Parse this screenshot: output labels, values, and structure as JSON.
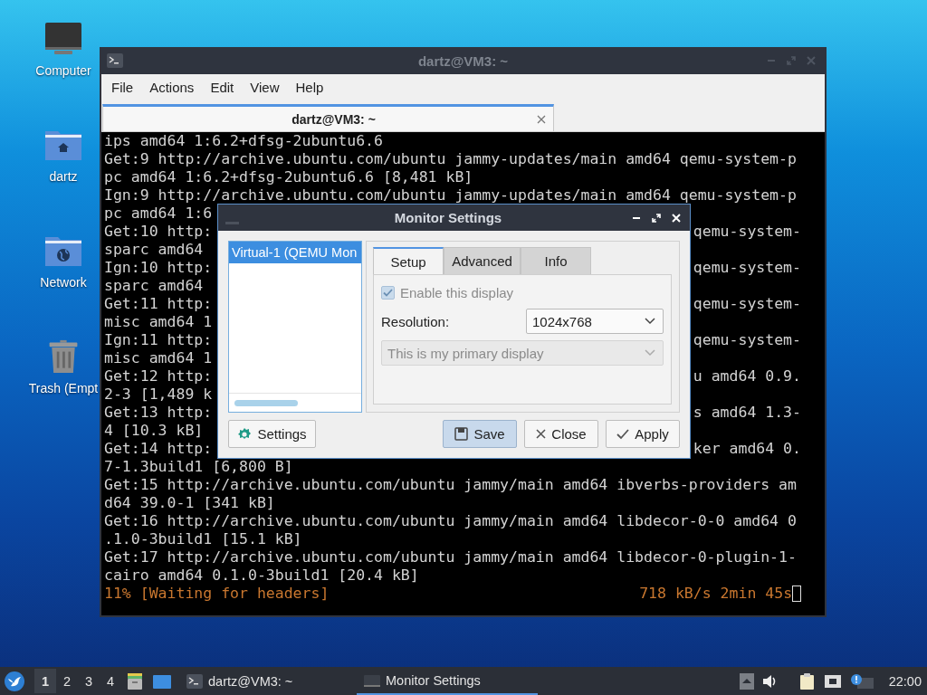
{
  "desktop_icons": [
    {
      "label": "Computer",
      "kind": "computer"
    },
    {
      "label": "dartz",
      "kind": "home"
    },
    {
      "label": "Network",
      "kind": "network"
    },
    {
      "label": "Trash (Empt",
      "kind": "trash"
    }
  ],
  "terminal": {
    "title": "dartz@VM3: ~",
    "menu": [
      "File",
      "Actions",
      "Edit",
      "View",
      "Help"
    ],
    "tabs": [
      {
        "label": "dartz@VM3: ~",
        "selected": true
      }
    ],
    "lines": [
      {
        "kind": "output",
        "left": "ips amd64 1:6.2+dfsg-2ubuntu6.6"
      },
      {
        "kind": "output",
        "left": "Get:9 http://archive.ubuntu.com/ubuntu jammy-updates/main amd64 qemu-system-p"
      },
      {
        "kind": "output",
        "left": "pc amd64 1:6.2+dfsg-2ubuntu6.6 [8,481 kB]"
      },
      {
        "kind": "output",
        "left": "Ign:9 http://archive.ubuntu.com/ubuntu jammy-updates/main amd64 qemu-system-p"
      },
      {
        "kind": "output",
        "left": "pc amd64 1:6"
      },
      {
        "kind": "output",
        "left": "Get:10 http:",
        "right": "qemu-system-"
      },
      {
        "kind": "output",
        "left": "sparc amd64 "
      },
      {
        "kind": "output",
        "left": "Ign:10 http:",
        "right": "qemu-system-"
      },
      {
        "kind": "output",
        "left": "sparc amd64 "
      },
      {
        "kind": "output",
        "left": "Get:11 http:",
        "right": "qemu-system-"
      },
      {
        "kind": "output",
        "left": "misc amd64 1"
      },
      {
        "kind": "output",
        "left": "Ign:11 http:",
        "right": "qemu-system-"
      },
      {
        "kind": "output",
        "left": "misc amd64 1"
      },
      {
        "kind": "output",
        "left": "Get:12 http:",
        "right": "u amd64 0.9."
      },
      {
        "kind": "output",
        "left": "2-3 [1,489 k"
      },
      {
        "kind": "output",
        "left": "Get:13 http:",
        "right": "s amd64 1.3-"
      },
      {
        "kind": "output",
        "left": "4 [10.3 kB]"
      },
      {
        "kind": "output",
        "left": "Get:14 http:",
        "right": "ker amd64 0."
      },
      {
        "kind": "output",
        "left": "7-1.3build1 [6,800 B]"
      },
      {
        "kind": "output",
        "left": "Get:15 http://archive.ubuntu.com/ubuntu jammy/main amd64 ibverbs-providers am"
      },
      {
        "kind": "output",
        "left": "d64 39.0-1 [341 kB]"
      },
      {
        "kind": "output",
        "left": "Get:16 http://archive.ubuntu.com/ubuntu jammy/main amd64 libdecor-0-0 amd64 0"
      },
      {
        "kind": "output",
        "left": ".1.0-3build1 [15.1 kB]"
      },
      {
        "kind": "output",
        "left": "Get:17 http://archive.ubuntu.com/ubuntu jammy/main amd64 libdecor-0-plugin-1-"
      },
      {
        "kind": "output",
        "left": "cairo amd64 0.1.0-3build1 [20.4 kB]"
      },
      {
        "kind": "status",
        "left": "11% [Waiting for headers]",
        "right": "718 kB/s 2min 45s"
      }
    ]
  },
  "dialog": {
    "title": "Monitor Settings",
    "monitors": [
      {
        "label": "Virtual-1 (QEMU Mon",
        "selected": true
      }
    ],
    "tabs": [
      {
        "label": "Setup",
        "selected": true
      },
      {
        "label": "Advanced",
        "selected": false
      },
      {
        "label": "Info",
        "selected": false
      }
    ],
    "enable_display": {
      "label": "Enable this display",
      "checked": true,
      "disabled": true
    },
    "resolution": {
      "label": "Resolution:",
      "value": "1024x768"
    },
    "primary": {
      "value": "This is my primary display",
      "disabled": true
    },
    "buttons": [
      {
        "kind": "settings",
        "label": "Settings",
        "default": false
      },
      {
        "kind": "save",
        "label": "Save",
        "default": true
      },
      {
        "kind": "close",
        "label": "Close",
        "default": false
      },
      {
        "kind": "apply",
        "label": "Apply",
        "default": false
      }
    ]
  },
  "taskbar": {
    "workspaces": [
      {
        "label": "1",
        "selected": true
      },
      {
        "label": "2",
        "selected": false
      },
      {
        "label": "3",
        "selected": false
      },
      {
        "label": "4",
        "selected": false
      }
    ],
    "tasks": [
      {
        "kind": "terminal",
        "label": "dartz@VM3: ~",
        "selected": false
      },
      {
        "kind": "window",
        "label": "Monitor Settings",
        "selected": true
      }
    ],
    "clock": "22:00"
  }
}
